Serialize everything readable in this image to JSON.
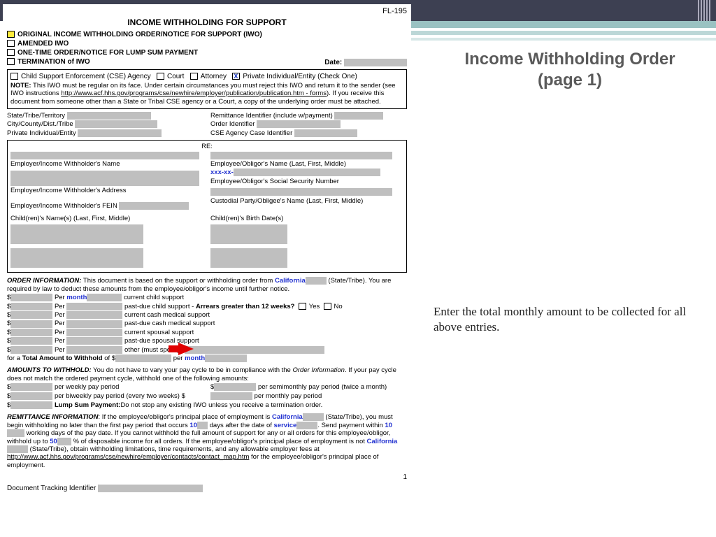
{
  "slide": {
    "title_line1": "Income Withholding Order",
    "title_line2": "(page 1)",
    "caption": "Enter the total monthly amount to be collected for all above entries."
  },
  "form": {
    "code": "FL-195",
    "title": "INCOME WITHHOLDING FOR SUPPORT",
    "opts": {
      "original": "ORIGINAL INCOME WITHHOLDING ORDER/NOTICE FOR SUPPORT (IWO)",
      "amended": "AMENDED IWO",
      "onetime": "ONE-TIME ORDER/NOTICE FOR LUMP SUM PAYMENT",
      "termination": "TERMINATION of IWO"
    },
    "date_label": "Date:",
    "sender_row": {
      "cse": "Child Support Enforcement (CSE) Agency",
      "court": "Court",
      "attorney": "Attorney",
      "private": "Private Individual/Entity   (Check One)"
    },
    "note_label": "NOTE:",
    "note_text1": " This IWO must be regular on its face. Under certain circumstances you must reject this IWO and return it to the sender (see IWO instructions ",
    "note_link": "http://www.acf.hhs.gov/programs/cse/newhire/employer/publication/publication.htm - forms",
    "note_text2": "). If you receive this document from someone other than a State or Tribal CSE agency or a Court, a copy of the underlying order must be attached.",
    "ids": {
      "state": "State/Tribe/Territory",
      "city": "City/County/Dist./Tribe",
      "priv": "Private Individual/Entity",
      "remit": "Remittance Identifier (include w/payment)",
      "order": "Order Identifier",
      "cseid": "CSE Agency Case Identifier"
    },
    "parties": {
      "re": "RE:",
      "emp_name": "Employer/Income Withholder's Name",
      "emp_addr": "Employer/Income Withholder's Address",
      "emp_fein": "Employer/Income Withholder's FEIN",
      "obl_name": "Employee/Obligor's Name (Last, First, Middle)",
      "ssn_masked": "xxx-xx-",
      "ssn_label": "Employee/Obligor's Social Security Number",
      "cust_name": "Custodial Party/Obligee's Name (Last, First, Middle)",
      "child_names": "Child(ren)'s Name(s) (Last, First, Middle)",
      "child_dob": "Child(ren)'s Birth Date(s)"
    },
    "order": {
      "header": "ORDER INFORMATION:",
      "intro1": " This document is based on the support or withholding order from ",
      "state_val": "California",
      "intro2": " (State/Tribe). You are required by law to deduct these amounts from the employee/obligor's income until further notice.",
      "per": "Per",
      "month": "month",
      "lines": {
        "ccs": "current child support",
        "pcs": "past-due child support - ",
        "arrears_q": "Arrears greater than 12 weeks?",
        "yes": "Yes",
        "no": "No",
        "cms": "current cash medical support",
        "pms": "past-due cash medical support",
        "css": "current spousal support",
        "pss": "past-due spousal support",
        "other": "other (must specify)"
      },
      "total_label": "for a",
      "total_bold": "Total Amount to Withhold",
      "total_of": "of $",
      "per2": "per"
    },
    "amounts": {
      "header": "AMOUNTS TO WITHHOLD:",
      "intro": " You do not have to vary your pay cycle to be in compliance with the ",
      "oi_italic": "Order Information",
      "intro2": ". If your pay cycle does not match the ordered payment cycle, withhold one of the following amounts:",
      "weekly": "per weekly pay period",
      "biweekly": "per biweekly pay period (every two weeks) $",
      "semimonthly": "per semimonthly pay period (twice a month)",
      "monthly": "per monthly pay period",
      "lump": "Lump Sum Payment:",
      "lump_text": " Do not stop any existing IWO unless you receive a termination order."
    },
    "remit": {
      "header": "REMITTANCE INFORMATION",
      "t1": ": If the employee/obligor's principal place of employment is ",
      "state1": "California",
      "t2": " (State/Tribe), you must begin withholding no later than the first pay period that occurs",
      "v10a": "10",
      "t3": " days after the date of ",
      "service": "service",
      "t4": ". Send payment within ",
      "v10b": "10",
      "t5": " working days of the pay date. If you cannot withhold the full amount of support for any or all orders for this employee/obligor, withhold up to ",
      "v50": "50",
      "t6": " % of disposable income for all orders. If the employee/obligor's principal place of employment is not ",
      "state2": "California",
      "t7": " (State/Tribe), obtain withholding limitations, time requirements, and any allowable employer fees at ",
      "link": "http://www.acf.hhs.gov/programs/cse/newhire/employer/contacts/contact_map.htm",
      "t8": " for the employee/obligor's principal place of employment."
    },
    "page_num": "1",
    "tracking": "Document Tracking Identifier"
  }
}
